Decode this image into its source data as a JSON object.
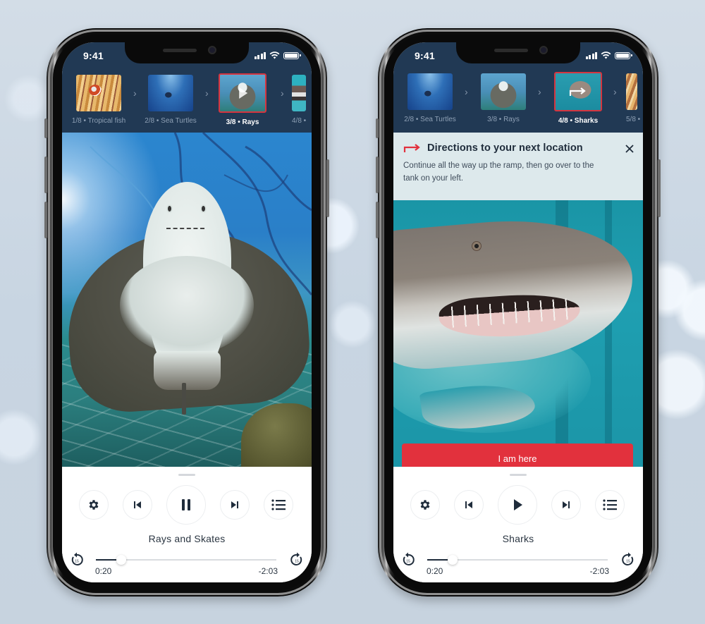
{
  "theme": {
    "header_bg": "#213954",
    "accent_red": "#e2313d",
    "text_dark": "#1f2c3b",
    "directions_bg": "#dde9ec",
    "background": "#c9d6e3"
  },
  "phones": [
    {
      "status": {
        "time": "9:41",
        "icons": [
          "signal-icon",
          "wifi-icon",
          "battery-icon"
        ]
      },
      "carousel": [
        {
          "label": "1/8 • Tropical fish",
          "thumb": "tropical-fish",
          "active": false
        },
        {
          "label": "2/8 •  Sea Turtles",
          "thumb": "sea-turtle",
          "active": false
        },
        {
          "label": "3/8 • Rays",
          "thumb": "ray",
          "active": true,
          "overlay_icon": "play-icon"
        },
        {
          "label": "4/8 •",
          "thumb": "shark",
          "active": false
        }
      ],
      "main_image": "Ray swimming overhead",
      "player": {
        "title": "Rays and Skates",
        "state": "playing",
        "center_button_icon": "pause-icon",
        "elapsed": "0:20",
        "remaining": "-2:03",
        "progress_fraction": 0.14,
        "skip_back_seconds": "15",
        "skip_forward_seconds": "15",
        "buttons": [
          "settings",
          "previous",
          "pause",
          "next",
          "playlist"
        ]
      }
    },
    {
      "status": {
        "time": "9:41",
        "icons": [
          "signal-icon",
          "wifi-icon",
          "battery-icon"
        ]
      },
      "carousel": [
        {
          "label": "2/8 • Sea Turtles",
          "thumb": "sea-turtle",
          "active": false
        },
        {
          "label": "3/8 • Rays",
          "thumb": "ray",
          "active": false
        },
        {
          "label": "4/8 • Sharks",
          "thumb": "shark",
          "active": true,
          "overlay_icon": "directions-arrow-icon"
        },
        {
          "label": "5/8 •",
          "thumb": "tropical-fish",
          "active": false
        }
      ],
      "directions": {
        "title": "Directions to your next location",
        "body": "Continue all the way up the ramp, then go over to the tank on your left.",
        "icon": "directions-arrow-icon",
        "close_icon": "close-icon"
      },
      "main_image": "Sand tiger shark close-up",
      "cta_label": "I am here",
      "player": {
        "title": "Sharks",
        "state": "paused",
        "center_button_icon": "play-icon",
        "elapsed": "0:20",
        "remaining": "-2:03",
        "progress_fraction": 0.14,
        "skip_back_seconds": "15",
        "skip_forward_seconds": "15",
        "buttons": [
          "settings",
          "previous",
          "play",
          "next",
          "playlist"
        ]
      }
    }
  ]
}
